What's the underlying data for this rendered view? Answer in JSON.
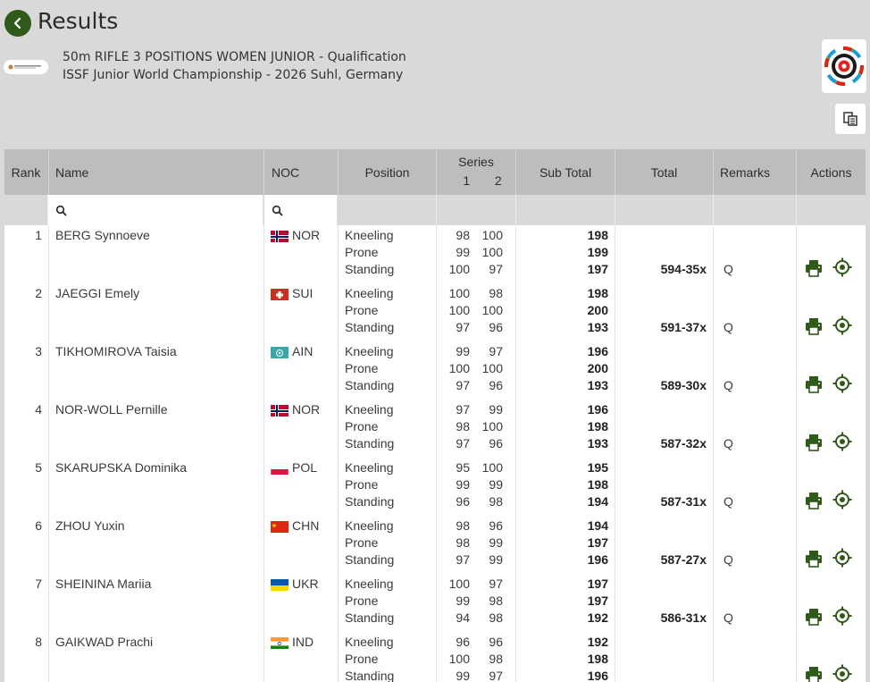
{
  "header": {
    "title": "Results",
    "event_name": "50m RIFLE 3 POSITIONS WOMEN JUNIOR - Qualification",
    "championship": "ISSF Junior World Championship - 2026 Suhl, Germany"
  },
  "columns": {
    "rank": "Rank",
    "name": "Name",
    "noc": "NOC",
    "position": "Position",
    "series": "Series",
    "series_1": "1",
    "series_2": "2",
    "sub_total": "Sub Total",
    "total": "Total",
    "remarks": "Remarks",
    "actions": "Actions"
  },
  "filters": {
    "name_value": "",
    "noc_value": ""
  },
  "rows": [
    {
      "rank": "1",
      "name": "BERG Synnoeve",
      "noc": "NOR",
      "flag": "nor",
      "positions": [
        {
          "label": "Kneeling",
          "s1": "98",
          "s2": "100",
          "sub": "198"
        },
        {
          "label": "Prone",
          "s1": "99",
          "s2": "100",
          "sub": "199"
        },
        {
          "label": "Standing",
          "s1": "100",
          "s2": "97",
          "sub": "197"
        }
      ],
      "total": "594-35x",
      "remark": "Q"
    },
    {
      "rank": "2",
      "name": "JAEGGI Emely",
      "noc": "SUI",
      "flag": "sui",
      "positions": [
        {
          "label": "Kneeling",
          "s1": "100",
          "s2": "98",
          "sub": "198"
        },
        {
          "label": "Prone",
          "s1": "100",
          "s2": "100",
          "sub": "200"
        },
        {
          "label": "Standing",
          "s1": "97",
          "s2": "96",
          "sub": "193"
        }
      ],
      "total": "591-37x",
      "remark": "Q"
    },
    {
      "rank": "3",
      "name": "TIKHOMIROVA Taisia",
      "noc": "AIN",
      "flag": "ain",
      "positions": [
        {
          "label": "Kneeling",
          "s1": "99",
          "s2": "97",
          "sub": "196"
        },
        {
          "label": "Prone",
          "s1": "100",
          "s2": "100",
          "sub": "200"
        },
        {
          "label": "Standing",
          "s1": "97",
          "s2": "96",
          "sub": "193"
        }
      ],
      "total": "589-30x",
      "remark": "Q"
    },
    {
      "rank": "4",
      "name": "NOR-WOLL Pernille",
      "noc": "NOR",
      "flag": "nor",
      "positions": [
        {
          "label": "Kneeling",
          "s1": "97",
          "s2": "99",
          "sub": "196"
        },
        {
          "label": "Prone",
          "s1": "98",
          "s2": "100",
          "sub": "198"
        },
        {
          "label": "Standing",
          "s1": "97",
          "s2": "96",
          "sub": "193"
        }
      ],
      "total": "587-32x",
      "remark": "Q"
    },
    {
      "rank": "5",
      "name": "SKARUPSKA Dominika",
      "noc": "POL",
      "flag": "pol",
      "positions": [
        {
          "label": "Kneeling",
          "s1": "95",
          "s2": "100",
          "sub": "195"
        },
        {
          "label": "Prone",
          "s1": "99",
          "s2": "99",
          "sub": "198"
        },
        {
          "label": "Standing",
          "s1": "96",
          "s2": "98",
          "sub": "194"
        }
      ],
      "total": "587-31x",
      "remark": "Q"
    },
    {
      "rank": "6",
      "name": "ZHOU Yuxin",
      "noc": "CHN",
      "flag": "chn",
      "positions": [
        {
          "label": "Kneeling",
          "s1": "98",
          "s2": "96",
          "sub": "194"
        },
        {
          "label": "Prone",
          "s1": "98",
          "s2": "99",
          "sub": "197"
        },
        {
          "label": "Standing",
          "s1": "97",
          "s2": "99",
          "sub": "196"
        }
      ],
      "total": "587-27x",
      "remark": "Q"
    },
    {
      "rank": "7",
      "name": "SHEININA Mariia",
      "noc": "UKR",
      "flag": "ukr",
      "positions": [
        {
          "label": "Kneeling",
          "s1": "100",
          "s2": "97",
          "sub": "197"
        },
        {
          "label": "Prone",
          "s1": "99",
          "s2": "98",
          "sub": "197"
        },
        {
          "label": "Standing",
          "s1": "94",
          "s2": "98",
          "sub": "192"
        }
      ],
      "total": "586-31x",
      "remark": "Q"
    },
    {
      "rank": "8",
      "name": "GAIKWAD Prachi",
      "noc": "IND",
      "flag": "ind",
      "positions": [
        {
          "label": "Kneeling",
          "s1": "96",
          "s2": "96",
          "sub": "192"
        },
        {
          "label": "Prone",
          "s1": "100",
          "s2": "98",
          "sub": "198"
        },
        {
          "label": "Standing",
          "s1": "99",
          "s2": "97",
          "sub": "196"
        }
      ],
      "total": "",
      "remark": ""
    }
  ],
  "icons": {
    "back": "chevron-left-icon",
    "search": "search-icon",
    "print": "printer-icon",
    "target": "crosshair-icon",
    "export": "export-icon"
  },
  "colors": {
    "accent": "#2f5a1a",
    "header_bg": "#bdbdbd",
    "page_bg": "#d9d9d9"
  }
}
